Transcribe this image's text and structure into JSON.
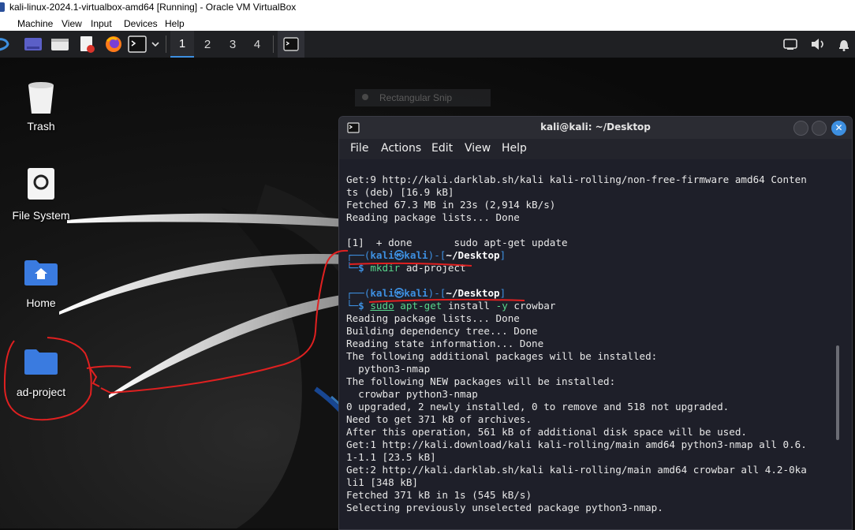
{
  "vbox": {
    "title": "kali-linux-2024.1-virtualbox-amd64 [Running] - Oracle VM VirtualBox",
    "menu": [
      "Machine",
      "View",
      "Input",
      "Devices",
      "Help"
    ]
  },
  "panel": {
    "workspaces": [
      "1",
      "2",
      "3",
      "4"
    ],
    "active_workspace": "1"
  },
  "desktop": {
    "icons": [
      {
        "label": "Trash"
      },
      {
        "label": "File System"
      },
      {
        "label": "Home"
      },
      {
        "label": "ad-project"
      }
    ]
  },
  "snip": {
    "label": "Rectangular Snip"
  },
  "terminal": {
    "title": "kali@kali: ~/Desktop",
    "menu": [
      "File",
      "Actions",
      "Edit",
      "View",
      "Help"
    ],
    "lines": {
      "l1": "Get:9 http://kali.darklab.sh/kali kali-rolling/non-free-firmware amd64 Conten",
      "l2": "ts (deb) [16.9 kB]",
      "l3": "Fetched 67.3 MB in 23s (2,914 kB/s)",
      "l4": "Reading package lists... Done",
      "l5": "[1]  + done       sudo apt-get update",
      "p_user": "kali",
      "p_at": "㉿",
      "p_host": "kali",
      "p_dir": "~/Desktop",
      "cmd1_a": "mkdir",
      "cmd1_b": " ad-project",
      "cmd2_a": "sudo",
      "cmd2_b": "apt-get",
      "cmd2_c": " install ",
      "cmd2_d": "-y",
      "cmd2_e": " crowbar",
      "o1": "Reading package lists... Done",
      "o2": "Building dependency tree... Done",
      "o3": "Reading state information... Done",
      "o4": "The following additional packages will be installed:",
      "o5": "  python3-nmap",
      "o6": "The following NEW packages will be installed:",
      "o7": "  crowbar python3-nmap",
      "o8": "0 upgraded, 2 newly installed, 0 to remove and 518 not upgraded.",
      "o9": "Need to get 371 kB of archives.",
      "o10": "After this operation, 561 kB of additional disk space will be used.",
      "o11": "Get:1 http://kali.download/kali kali-rolling/main amd64 python3-nmap all 0.6.",
      "o12": "1-1.1 [23.5 kB]",
      "o13": "Get:2 http://kali.darklab.sh/kali kali-rolling/main amd64 crowbar all 4.2-0ka",
      "o14": "li1 [348 kB]",
      "o15": "Fetched 371 kB in 1s (545 kB/s)",
      "o16": "Selecting previously unselected package python3-nmap."
    }
  },
  "colors": {
    "accent": "#3d8fe0",
    "command": "#59d68c",
    "annotation": "#e02020"
  }
}
